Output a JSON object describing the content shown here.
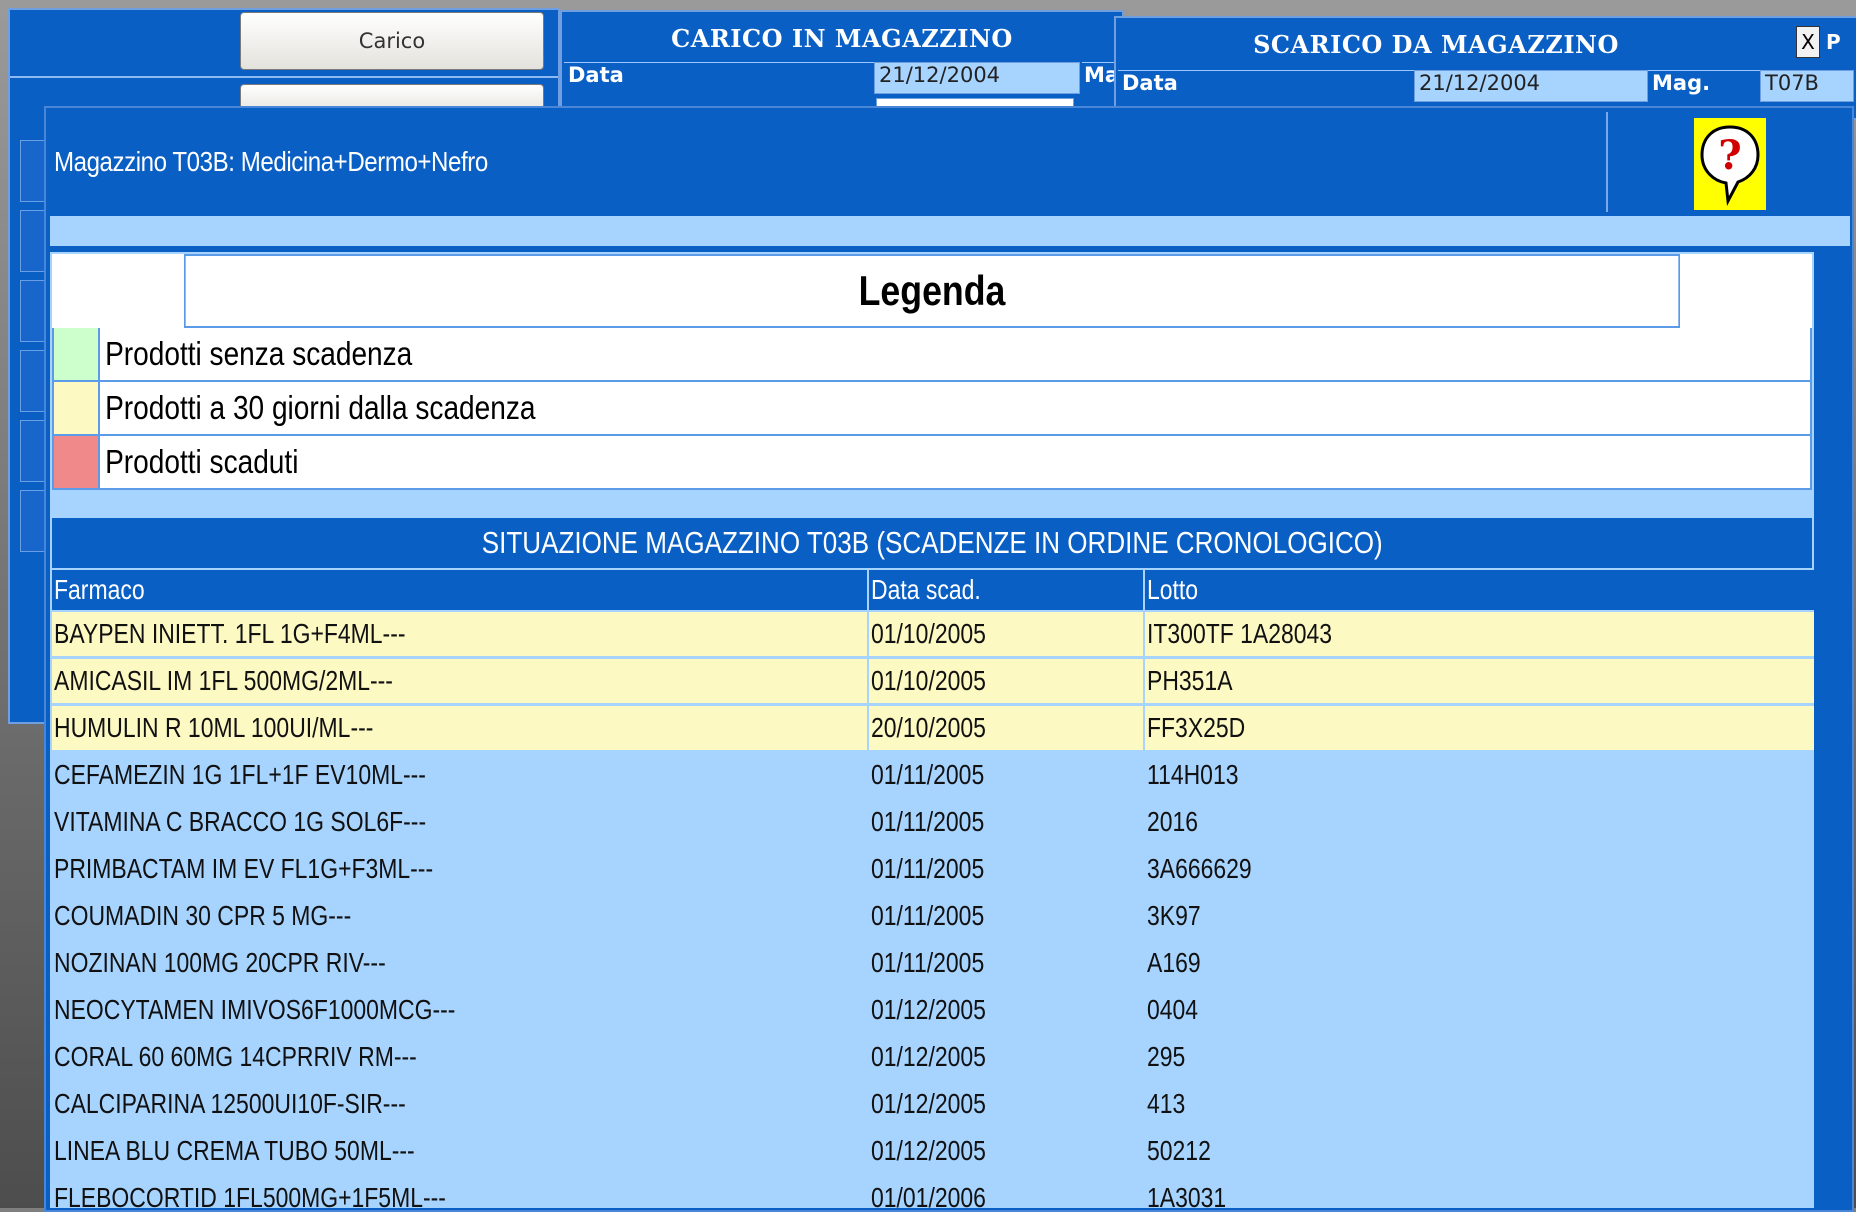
{
  "colors": {
    "window_blue": "#0a5fc4",
    "light_blue": "#a7d3ff",
    "legend_green": "#ccffcc",
    "legend_yellow": "#fdf9c3",
    "legend_red": "#f08a8a",
    "help_yellow": "#ffff00"
  },
  "back_left": {
    "carico_button": "Carico",
    "second_button": ""
  },
  "carico_window": {
    "title": "CARICO IN MAGAZZINO",
    "data_label": "Data",
    "data_value": "21/12/2004",
    "mag_label": "Ma"
  },
  "scarico_window": {
    "title": "SCARICO DA MAGAZZINO",
    "data_label": "Data",
    "data_value": "21/12/2004",
    "mag_label": "Mag.",
    "mag_value": "T07B",
    "close_label": "X",
    "p_label": "P"
  },
  "main": {
    "title": "Magazzino T03B: Medicina+Dermo+Nefro",
    "help_icon": "question-balloon-icon",
    "legend": {
      "title": "Legenda",
      "items": [
        {
          "label": "Prodotti senza scadenza",
          "color": "#ccffcc"
        },
        {
          "label": "Prodotti a 30 giorni dalla scadenza",
          "color": "#fdf9c3"
        },
        {
          "label": "Prodotti scaduti",
          "color": "#f08a8a"
        }
      ]
    },
    "situation_title": "SITUAZIONE MAGAZZINO T03B (SCADENZE IN ORDINE CRONOLOGICO)",
    "table": {
      "columns": [
        "Farmaco",
        "Data scad.",
        "Lotto"
      ],
      "rows": [
        {
          "farmaco": "BAYPEN INIETT. 1FL 1G+F4ML---",
          "data": "01/10/2005",
          "lotto": "IT300TF 1A28043",
          "status": "warn"
        },
        {
          "farmaco": "AMICASIL IM 1FL 500MG/2ML---",
          "data": "01/10/2005",
          "lotto": "PH351A",
          "status": "warn"
        },
        {
          "farmaco": "HUMULIN R 10ML 100UI/ML---",
          "data": "20/10/2005",
          "lotto": "FF3X25D",
          "status": "warn"
        },
        {
          "farmaco": "CEFAMEZIN 1G 1FL+1F EV10ML---",
          "data": "01/11/2005",
          "lotto": "114H013",
          "status": "ok"
        },
        {
          "farmaco": "VITAMINA C BRACCO 1G SOL6F---",
          "data": "01/11/2005",
          "lotto": "2016",
          "status": "ok"
        },
        {
          "farmaco": "PRIMBACTAM IM EV FL1G+F3ML---",
          "data": "01/11/2005",
          "lotto": "3A666629",
          "status": "ok"
        },
        {
          "farmaco": "COUMADIN 30 CPR 5 MG---",
          "data": "01/11/2005",
          "lotto": "3K97",
          "status": "ok"
        },
        {
          "farmaco": "NOZINAN 100MG 20CPR RIV---",
          "data": "01/11/2005",
          "lotto": "A169",
          "status": "ok"
        },
        {
          "farmaco": "NEOCYTAMEN IMIVOS6F1000MCG---",
          "data": "01/12/2005",
          "lotto": "0404",
          "status": "ok"
        },
        {
          "farmaco": "CORAL 60 60MG 14CPRRIV RM---",
          "data": "01/12/2005",
          "lotto": "295",
          "status": "ok"
        },
        {
          "farmaco": "CALCIPARINA 12500UI10F-SIR---",
          "data": "01/12/2005",
          "lotto": "413",
          "status": "ok"
        },
        {
          "farmaco": "LINEA BLU CREMA TUBO 50ML---",
          "data": "01/12/2005",
          "lotto": "50212",
          "status": "ok"
        },
        {
          "farmaco": "FLEBOCORTID 1FL500MG+1F5ML---",
          "data": "01/01/2006",
          "lotto": "1A3031",
          "status": "ok"
        }
      ]
    }
  }
}
